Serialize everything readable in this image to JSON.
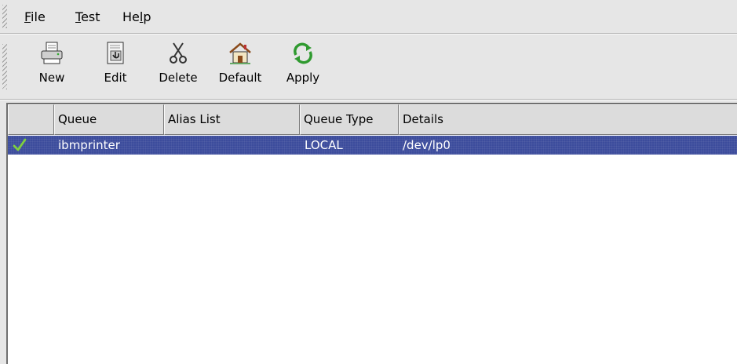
{
  "menubar": {
    "items": [
      {
        "mnemonic": "F",
        "rest": "ile"
      },
      {
        "mnemonic": "T",
        "rest": "est"
      },
      {
        "pre": "He",
        "mnemonic": "l",
        "rest": "p"
      }
    ]
  },
  "toolbar": {
    "buttons": [
      {
        "label": "New",
        "icon": "printer-icon"
      },
      {
        "label": "Edit",
        "icon": "edit-document-icon"
      },
      {
        "label": "Delete",
        "icon": "scissors-icon"
      },
      {
        "label": "Default",
        "icon": "home-icon"
      },
      {
        "label": "Apply",
        "icon": "refresh-arrows-icon"
      }
    ]
  },
  "queue_list": {
    "columns": [
      "",
      "Queue",
      "Alias List",
      "Queue Type",
      "Details"
    ],
    "rows": [
      {
        "status_icon": "checkmark-icon",
        "queue": "ibmprinter",
        "alias_list": "",
        "queue_type": "LOCAL",
        "details": "/dev/lp0",
        "selected": true
      }
    ]
  },
  "colors": {
    "selection": "#3c4c9c",
    "window_bg": "#e6e6e6",
    "list_bg": "#ffffff"
  }
}
